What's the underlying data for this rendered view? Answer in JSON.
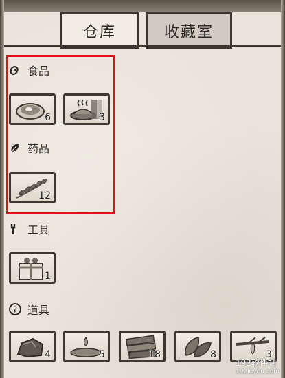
{
  "tabs": {
    "warehouse": "仓库",
    "collection": "收藏室"
  },
  "categories": {
    "food": {
      "label": "食品",
      "items": [
        {
          "icon": "meat-icon",
          "count": "6"
        },
        {
          "icon": "hot-dish-icon",
          "count": "3"
        }
      ]
    },
    "medicine": {
      "label": "药品",
      "items": [
        {
          "icon": "herb-icon",
          "count": "12"
        }
      ]
    },
    "tools": {
      "label": "工具",
      "items": [
        {
          "icon": "gift-box-icon",
          "count": "1"
        }
      ]
    },
    "props": {
      "label": "道具",
      "items": [
        {
          "icon": "stone-icon",
          "count": "4"
        },
        {
          "icon": "water-puddle-icon",
          "count": "5"
        },
        {
          "icon": "wood-planks-icon",
          "count": "18"
        },
        {
          "icon": "leaf-icon",
          "count": "8"
        },
        {
          "icon": "resin-branch-icon",
          "count": "3"
        }
      ]
    }
  },
  "watermark": {
    "main": "192软件站",
    "sub": "192luyou.com"
  },
  "colors": {
    "highlight": "#e0121b",
    "background": "#e9e4da",
    "ink": "#3a352e"
  }
}
